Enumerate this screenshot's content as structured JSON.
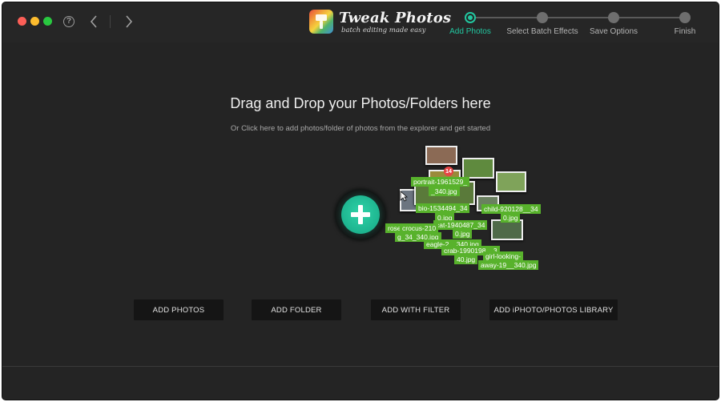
{
  "window": {
    "help_label": "?"
  },
  "brand": {
    "title": "Tweak Photos",
    "tagline": "batch editing made easy"
  },
  "steps": [
    {
      "label": "Add Photos",
      "active": true
    },
    {
      "label": "Select Batch Effects",
      "active": false
    },
    {
      "label": "Save Options",
      "active": false
    },
    {
      "label": "Finish",
      "active": false
    }
  ],
  "dropzone": {
    "heading": "Drag and Drop your Photos/Folders here",
    "subtext": "Or Click here to add photos/folder of photos from the explorer and get started"
  },
  "collage": {
    "count_badge": "14",
    "file_tags": [
      "portrait-1961529_",
      "_340.jpg",
      "bio-1534494_34",
      "0.jpg",
      "cat-1940487_34",
      "child-920128__34",
      "0.jpg",
      "rose",
      "crocus-210",
      "g_34_340.jpg",
      "0.jpg",
      "eagle-2__340.jpg",
      "crab-1990198__3",
      "40.jpg",
      "girl-looking-",
      "away-19__340.jpg"
    ]
  },
  "actions": [
    {
      "label": "ADD PHOTOS"
    },
    {
      "label": "ADD FOLDER"
    },
    {
      "label": "ADD WITH FILTER"
    },
    {
      "label": "ADD iPHOTO/PHOTOS LIBRARY"
    }
  ],
  "colors": {
    "accent": "#22c7a0",
    "background": "#242424",
    "button_bg": "#151515",
    "tag_green": "#58b22c"
  }
}
